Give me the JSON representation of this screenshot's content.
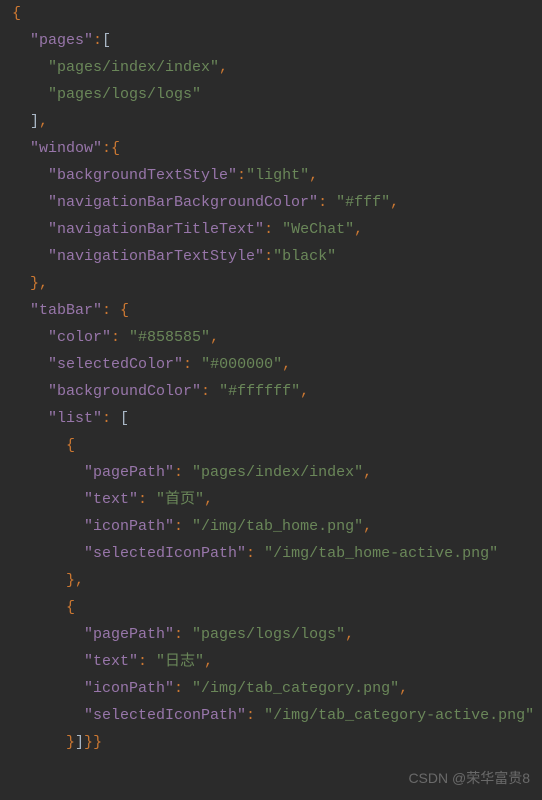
{
  "code": {
    "lines": [
      {
        "indent": 0,
        "content": [
          {
            "t": "brace",
            "v": "{"
          }
        ]
      },
      {
        "indent": 1,
        "content": [
          {
            "t": "key",
            "v": "\"pages\""
          },
          {
            "t": "colon",
            "v": ":"
          },
          {
            "t": "bracket",
            "v": "["
          }
        ]
      },
      {
        "indent": 2,
        "content": [
          {
            "t": "string",
            "v": "\"pages/index/index\""
          },
          {
            "t": "comma",
            "v": ","
          }
        ]
      },
      {
        "indent": 2,
        "content": [
          {
            "t": "string",
            "v": "\"pages/logs/logs\""
          }
        ]
      },
      {
        "indent": 1,
        "content": [
          {
            "t": "bracket",
            "v": "]"
          },
          {
            "t": "comma",
            "v": ","
          }
        ]
      },
      {
        "indent": 1,
        "content": [
          {
            "t": "key",
            "v": "\"window\""
          },
          {
            "t": "colon",
            "v": ":"
          },
          {
            "t": "brace",
            "v": "{"
          }
        ]
      },
      {
        "indent": 2,
        "content": [
          {
            "t": "key",
            "v": "\"backgroundTextStyle\""
          },
          {
            "t": "colon",
            "v": ":"
          },
          {
            "t": "string",
            "v": "\"light\""
          },
          {
            "t": "comma",
            "v": ","
          }
        ]
      },
      {
        "indent": 2,
        "content": [
          {
            "t": "key",
            "v": "\"navigationBarBackgroundColor\""
          },
          {
            "t": "colon",
            "v": ": "
          },
          {
            "t": "string",
            "v": "\"#fff\""
          },
          {
            "t": "comma",
            "v": ","
          }
        ]
      },
      {
        "indent": 2,
        "content": [
          {
            "t": "key",
            "v": "\"navigationBarTitleText\""
          },
          {
            "t": "colon",
            "v": ": "
          },
          {
            "t": "string",
            "v": "\"WeChat\""
          },
          {
            "t": "comma",
            "v": ","
          }
        ]
      },
      {
        "indent": 2,
        "content": [
          {
            "t": "key",
            "v": "\"navigationBarTextStyle\""
          },
          {
            "t": "colon",
            "v": ":"
          },
          {
            "t": "string",
            "v": "\"black\""
          }
        ]
      },
      {
        "indent": 1,
        "content": [
          {
            "t": "brace",
            "v": "}"
          },
          {
            "t": "comma",
            "v": ","
          }
        ]
      },
      {
        "indent": 1,
        "content": [
          {
            "t": "key",
            "v": "\"tabBar\""
          },
          {
            "t": "colon",
            "v": ": "
          },
          {
            "t": "brace",
            "v": "{"
          }
        ]
      },
      {
        "indent": 2,
        "content": [
          {
            "t": "key",
            "v": "\"color\""
          },
          {
            "t": "colon",
            "v": ": "
          },
          {
            "t": "string",
            "v": "\"#858585\""
          },
          {
            "t": "comma",
            "v": ","
          }
        ]
      },
      {
        "indent": 2,
        "content": [
          {
            "t": "key",
            "v": "\"selectedColor\""
          },
          {
            "t": "colon",
            "v": ": "
          },
          {
            "t": "string",
            "v": "\"#000000\""
          },
          {
            "t": "comma",
            "v": ","
          }
        ]
      },
      {
        "indent": 2,
        "content": [
          {
            "t": "key",
            "v": "\"backgroundColor\""
          },
          {
            "t": "colon",
            "v": ": "
          },
          {
            "t": "string",
            "v": "\"#ffffff\""
          },
          {
            "t": "comma",
            "v": ","
          }
        ]
      },
      {
        "indent": 2,
        "content": [
          {
            "t": "key",
            "v": "\"list\""
          },
          {
            "t": "colon",
            "v": ": "
          },
          {
            "t": "bracket",
            "v": "["
          }
        ]
      },
      {
        "indent": 3,
        "content": [
          {
            "t": "brace",
            "v": "{"
          }
        ]
      },
      {
        "indent": 4,
        "content": [
          {
            "t": "key",
            "v": "\"pagePath\""
          },
          {
            "t": "colon",
            "v": ": "
          },
          {
            "t": "string",
            "v": "\"pages/index/index\""
          },
          {
            "t": "comma",
            "v": ","
          }
        ]
      },
      {
        "indent": 4,
        "content": [
          {
            "t": "key",
            "v": "\"text\""
          },
          {
            "t": "colon",
            "v": ": "
          },
          {
            "t": "string",
            "v": "\"首页\""
          },
          {
            "t": "comma",
            "v": ","
          }
        ]
      },
      {
        "indent": 4,
        "content": [
          {
            "t": "key",
            "v": "\"iconPath\""
          },
          {
            "t": "colon",
            "v": ": "
          },
          {
            "t": "string",
            "v": "\"/img/tab_home.png\""
          },
          {
            "t": "comma",
            "v": ","
          }
        ]
      },
      {
        "indent": 4,
        "content": [
          {
            "t": "key",
            "v": "\"selectedIconPath\""
          },
          {
            "t": "colon",
            "v": ": "
          },
          {
            "t": "string",
            "v": "\"/img/tab_home-active.png\""
          }
        ]
      },
      {
        "indent": 3,
        "content": [
          {
            "t": "brace",
            "v": "}"
          },
          {
            "t": "comma",
            "v": ","
          }
        ]
      },
      {
        "indent": 3,
        "content": [
          {
            "t": "brace",
            "v": "{"
          }
        ]
      },
      {
        "indent": 4,
        "content": [
          {
            "t": "key",
            "v": "\"pagePath\""
          },
          {
            "t": "colon",
            "v": ": "
          },
          {
            "t": "string",
            "v": "\"pages/logs/logs\""
          },
          {
            "t": "comma",
            "v": ","
          }
        ]
      },
      {
        "indent": 4,
        "content": [
          {
            "t": "key",
            "v": "\"text\""
          },
          {
            "t": "colon",
            "v": ": "
          },
          {
            "t": "string",
            "v": "\"日志\""
          },
          {
            "t": "comma",
            "v": ","
          }
        ]
      },
      {
        "indent": 4,
        "content": [
          {
            "t": "key",
            "v": "\"iconPath\""
          },
          {
            "t": "colon",
            "v": ": "
          },
          {
            "t": "string",
            "v": "\"/img/tab_category.png\""
          },
          {
            "t": "comma",
            "v": ","
          }
        ]
      },
      {
        "indent": 4,
        "content": [
          {
            "t": "key",
            "v": "\"selectedIconPath\""
          },
          {
            "t": "colon",
            "v": ": "
          },
          {
            "t": "string",
            "v": "\"/img/tab_category-active.png\""
          }
        ]
      },
      {
        "indent": 3,
        "content": [
          {
            "t": "brace",
            "v": "}"
          },
          {
            "t": "bracket",
            "v": "]"
          },
          {
            "t": "brace",
            "v": "}"
          },
          {
            "t": "brace",
            "v": "}"
          }
        ]
      }
    ]
  },
  "watermark": "CSDN @荣华富贵8"
}
